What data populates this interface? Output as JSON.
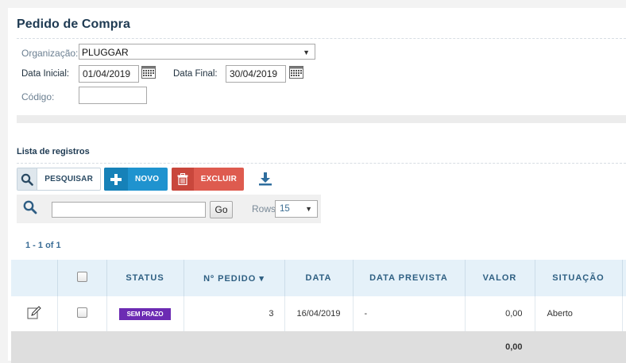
{
  "page": {
    "title": "Pedido de Compra"
  },
  "form": {
    "org_label": "Organização:",
    "org_value": "PLUGGAR",
    "data_inicial_label": "Data Inicial:",
    "data_inicial_value": "01/04/2019",
    "data_final_label": "Data Final:",
    "data_final_value": "30/04/2019",
    "codigo_label": "Código:",
    "codigo_value": ""
  },
  "list": {
    "title": "Lista de registros",
    "buttons": {
      "pesquisar": "PESQUISAR",
      "novo": "NOVO",
      "excluir": "EXCLUIR"
    },
    "filter": {
      "go_label": "Go",
      "rows_label": "Rows",
      "rows_value": "15"
    },
    "count": "1 - 1 of 1"
  },
  "table": {
    "columns": [
      "STATUS",
      "Nº PEDIDO ▾",
      "DATA",
      "DATA PREVISTA",
      "VALOR",
      "SITUAÇÃO"
    ],
    "rows": [
      {
        "status": "SEM PRAZO",
        "pedido": "3",
        "data": "16/04/2019",
        "data_prevista": "-",
        "valor": "0,00",
        "situacao": "Aberto"
      }
    ],
    "total_valor": "0,00"
  },
  "colors": {
    "accent_blue": "#1f93cf",
    "danger_red": "#de5b4f",
    "badge_purple": "#6c2bb3",
    "header_bg": "#e5f1f9"
  }
}
